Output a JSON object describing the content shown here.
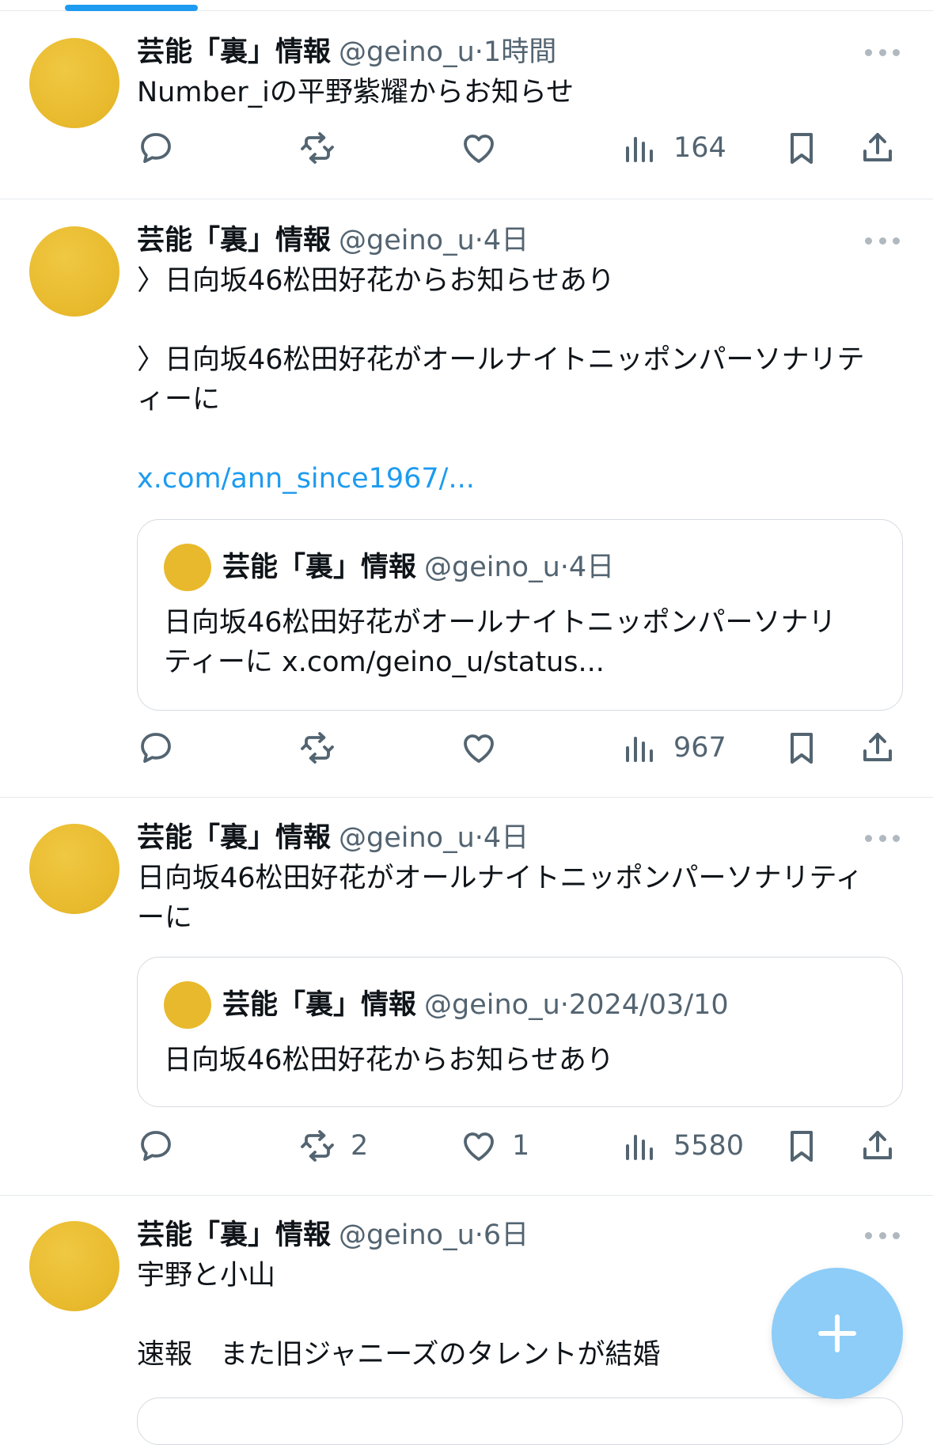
{
  "account": {
    "name": "芸能「裏」情報",
    "handle": "@geino_u",
    "dot": "·"
  },
  "tweets": [
    {
      "time": "1時間",
      "text": "Number_iの平野紫耀からお知らせ",
      "stats": {
        "replies": "",
        "retweets": "",
        "likes": "",
        "views": "164"
      }
    },
    {
      "time": "4日",
      "line1": "〉日向坂46松田好花からお知らせあり",
      "line2": "〉日向坂46松田好花がオールナイトニッポンパーソナリテ",
      "line3": "ィーに",
      "link": "x.com/ann_since1967/...",
      "quote": {
        "time": "4日",
        "line1": "日向坂46松田好花がオールナイトニッポンパーソナリ",
        "line2": "ティーに x.com/geino_u/status..."
      },
      "stats": {
        "replies": "",
        "retweets": "",
        "likes": "",
        "views": "967"
      }
    },
    {
      "time": "4日",
      "line1": "日向坂46松田好花がオールナイトニッポンパーソナリティ",
      "line2": "ーに",
      "quote": {
        "time": "2024/03/10",
        "line1": "日向坂46松田好花からお知らせあり"
      },
      "stats": {
        "replies": "",
        "retweets": "2",
        "likes": "1",
        "views": "5580"
      }
    },
    {
      "time": "6日",
      "line1": "宇野と小山",
      "line2": "速報　また旧ジャニーズのタレントが結婚"
    }
  ],
  "icons": {
    "reply": "reply-icon",
    "retweet": "retweet-icon",
    "like": "heart-icon",
    "views": "views-icon",
    "bookmark": "bookmark-icon",
    "share": "share-icon",
    "compose": "plus-icon",
    "more": "more-icon"
  },
  "colors": {
    "accent": "#1d9bf0",
    "fab": "#8dcdf8",
    "avatar": "#e8b92c",
    "muted": "#536471"
  }
}
